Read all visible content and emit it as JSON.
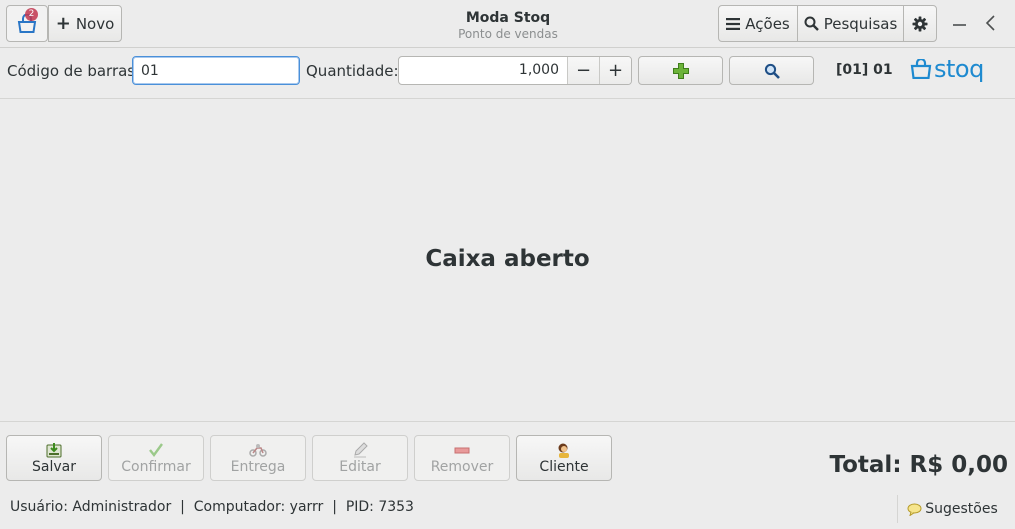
{
  "header": {
    "badge_count": "2",
    "new_label": "Novo",
    "title": "Moda Stoq",
    "subtitle": "Ponto de vendas",
    "actions_label": "Ações",
    "searches_label": "Pesquisas",
    "icons": [
      "shopping-bag-icon",
      "plus-icon",
      "menu-icon",
      "search-icon",
      "gear-icon",
      "minimize-icon",
      "chevron-left-icon"
    ]
  },
  "toolbar": {
    "barcode_label": "Código de barras:",
    "barcode_value": "01",
    "quantity_label": "Quantidade:",
    "quantity_value": "1,000",
    "minus_label": "−",
    "plus_label": "+",
    "station": "[01] 01",
    "logo_text": "stoq"
  },
  "main": {
    "status_text": "Caixa aberto"
  },
  "actions": [
    {
      "label": "Salvar",
      "enabled": true
    },
    {
      "label": "Confirmar",
      "enabled": false
    },
    {
      "label": "Entrega",
      "enabled": false
    },
    {
      "label": "Editar",
      "enabled": false
    },
    {
      "label": "Remover",
      "enabled": false
    },
    {
      "label": "Cliente",
      "enabled": true
    }
  ],
  "total": "Total: R$ 0,00",
  "status_bar": {
    "text": "Usuário: Administrador  |  Computador: yarrr  |  PID: 7353"
  },
  "suggestions_label": "Sugestões",
  "colors": {
    "accent": "#4a90d9",
    "logo": "#1e8ad0",
    "badge": "#c2374f",
    "add_green": "#5ea62a"
  }
}
